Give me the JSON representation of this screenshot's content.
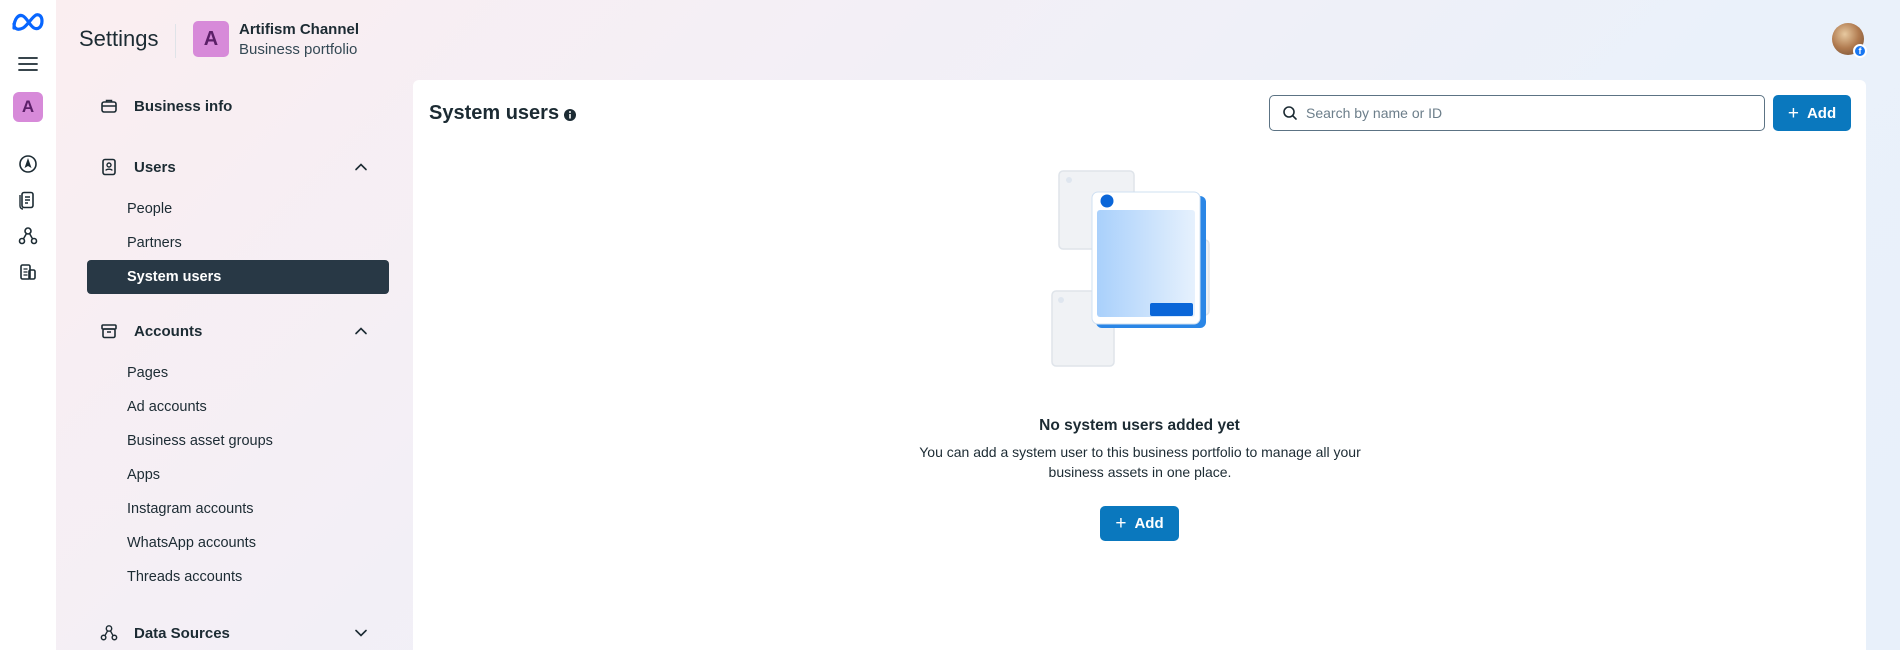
{
  "header": {
    "title": "Settings",
    "business_initial": "A",
    "business_name": "Artifism Channel",
    "business_subtitle": "Business portfolio"
  },
  "rail": {
    "account_initial": "A",
    "icons": [
      "meta-logo-icon",
      "menu-icon",
      "compass-icon",
      "pages-icon",
      "data-sources-icon",
      "billing-icon"
    ]
  },
  "sidebar": {
    "business_info": "Business info",
    "users": {
      "label": "Users",
      "items": [
        "People",
        "Partners",
        "System users"
      ]
    },
    "accounts": {
      "label": "Accounts",
      "items": [
        "Pages",
        "Ad accounts",
        "Business asset groups",
        "Apps",
        "Instagram accounts",
        "WhatsApp accounts",
        "Threads accounts"
      ]
    },
    "data_sources": "Data Sources"
  },
  "main": {
    "title": "System users",
    "search_placeholder": "Search by name or ID",
    "add_label": "Add",
    "empty_title": "No system users added yet",
    "empty_description": "You can add a system user to this business portfolio to manage all your business assets in one place.",
    "empty_add_label": "Add"
  },
  "colors": {
    "primary_button": "#0a78be",
    "active_nav": "#283845",
    "business_avatar": "#d78ad9"
  }
}
